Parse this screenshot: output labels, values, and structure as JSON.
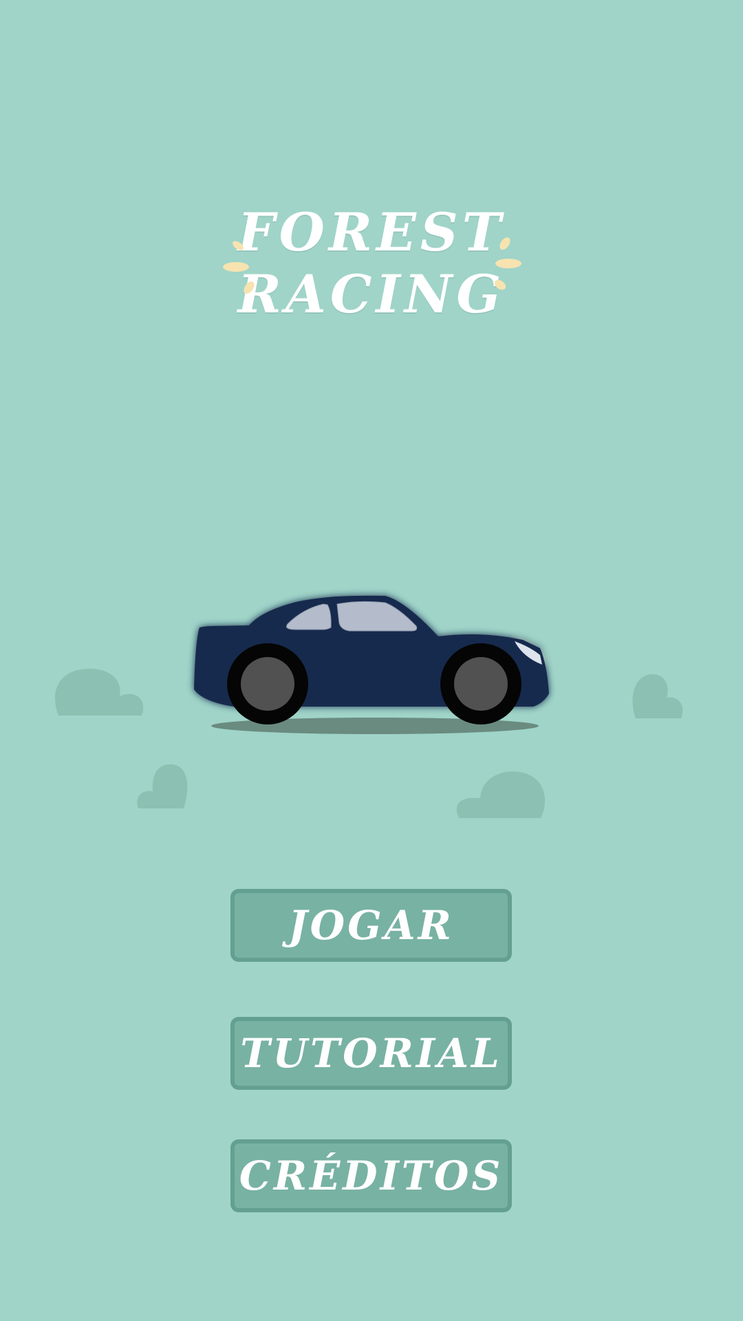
{
  "game": {
    "title_line1": "FOREST",
    "title_line2": "RACING"
  },
  "menu": {
    "play_label": "JOGAR",
    "tutorial_label": "TUTORIAL",
    "credits_label": "CRÉDITOS"
  },
  "colors": {
    "background": "#a0d4c8",
    "button_fill": "#78b2a3",
    "button_border": "#64a091",
    "car_body": "#152b4e",
    "car_window": "#b4bccc",
    "bush": "#8cc0b2",
    "sparkle": "#f7e3b0"
  }
}
